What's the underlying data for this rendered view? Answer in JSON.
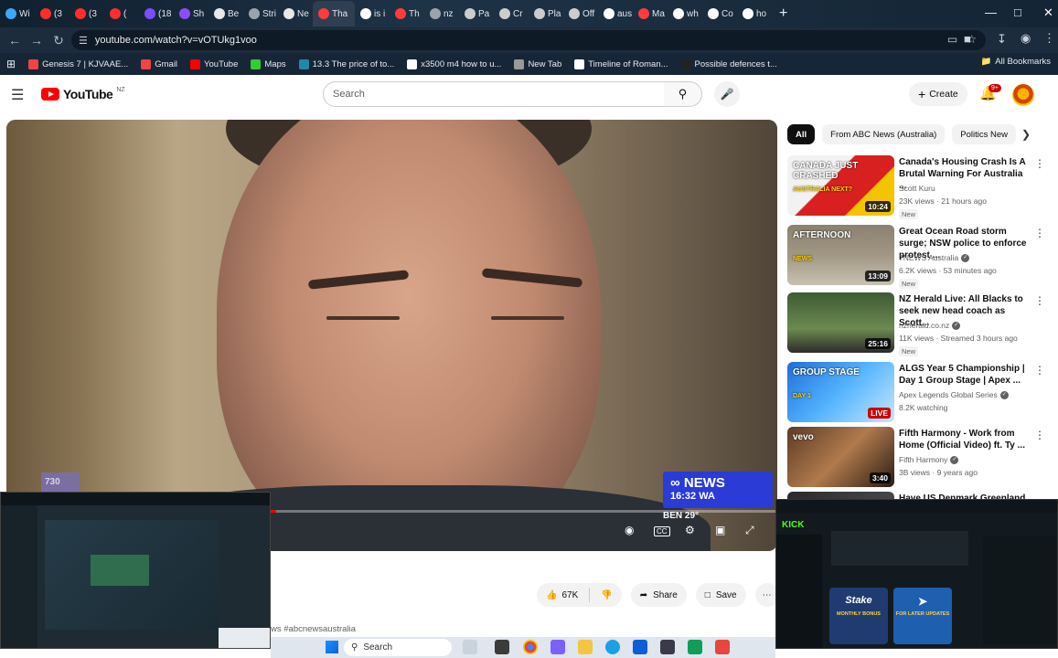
{
  "browser": {
    "tabs": [
      {
        "label": "Wi",
        "color": "#3aa8ff"
      },
      {
        "label": "(3",
        "color": "#ff2d2d"
      },
      {
        "label": "(3",
        "color": "#ff2d2d"
      },
      {
        "label": "(",
        "color": "#ff2d2d"
      },
      {
        "label": "(18",
        "color": "#7b4dff"
      },
      {
        "label": "Sh",
        "color": "#8a4dff"
      },
      {
        "label": "Be",
        "color": "#e8e8e8"
      },
      {
        "label": "Stri",
        "color": "#9aa4ad"
      },
      {
        "label": "Ne",
        "color": "#e8e8e8"
      },
      {
        "label": "Tha",
        "color": "#ff3b3b"
      },
      {
        "label": "is i",
        "color": "#ffffff"
      },
      {
        "label": "Th",
        "color": "#ff3b3b"
      },
      {
        "label": "nz",
        "color": "#9aa4ad"
      },
      {
        "label": "Pa",
        "color": "#cccccc"
      },
      {
        "label": "Cr",
        "color": "#cccccc"
      },
      {
        "label": "Pla",
        "color": "#cccccc"
      },
      {
        "label": "Off",
        "color": "#cccccc"
      },
      {
        "label": "aus",
        "color": "#ffffff"
      },
      {
        "label": "Ma",
        "color": "#ff3b3b"
      },
      {
        "label": "wh",
        "color": "#ffffff"
      },
      {
        "label": "Co",
        "color": "#ffffff"
      },
      {
        "label": "ho",
        "color": "#ffffff"
      }
    ],
    "new_tab_icon": "+",
    "url": "youtube.com/watch?v=vOTUkg1voo",
    "bookmarks": [
      {
        "label": "Genesis 7 | KJVAAE...",
        "color": "#e44"
      },
      {
        "label": "Gmail",
        "color": "#e44"
      },
      {
        "label": "YouTube",
        "color": "#f00"
      },
      {
        "label": "Maps",
        "color": "#3c3"
      },
      {
        "label": "13.3 The price of to...",
        "color": "#28a"
      },
      {
        "label": "x3500 m4 how to u...",
        "color": "#fff"
      },
      {
        "label": "New Tab",
        "color": "#999"
      },
      {
        "label": "Timeline of Roman...",
        "color": "#fff"
      },
      {
        "label": "Possible defences t...",
        "color": "#222"
      }
    ],
    "all_bookmarks": "All Bookmarks"
  },
  "header": {
    "logo_text": "YouTube",
    "logo_region": "NZ",
    "search_placeholder": "Search",
    "create_label": "Create",
    "notification_count": "9+"
  },
  "player": {
    "news_brand": "NEWS",
    "news_time": "16:32 WA",
    "news_weather": "BEN    29°",
    "corner_logo": "730",
    "progress": 0.35
  },
  "actions": {
    "likes": "67K",
    "share_label": "Share",
    "save_label": "Save",
    "more_icon": "⋯"
  },
  "description_snippet": "ws #abcnewsaustralia",
  "chips": [
    "All",
    "From ABC News (Australia)",
    "Politics New"
  ],
  "recommendations": [
    {
      "title": "Canada's Housing Crash Is A Brutal Warning For Australia ...",
      "channel": "Scott Kuru",
      "meta": "23K views · 21 hours ago",
      "badge": "New",
      "duration": "10:24",
      "thumb_text": "CANADA JUST CRASHED",
      "thumb_sub": "AUSTRALIA NEXT?",
      "verified": false
    },
    {
      "title": "Great Ocean Road storm surge; NSW police to enforce protest ...",
      "channel": "7NEWS Australia",
      "meta": "6.2K views · 53 minutes ago",
      "badge": "New",
      "duration": "13:09",
      "thumb_text": "AFTERNOON",
      "thumb_sub": "NEWS",
      "verified": true
    },
    {
      "title": "NZ Herald Live: All Blacks to seek new head coach as Scott...",
      "channel": "nzherald.co.nz",
      "meta": "11K views · Streamed 3 hours ago",
      "badge": "New",
      "duration": "25:16",
      "thumb_text": "",
      "thumb_sub": "",
      "verified": true
    },
    {
      "title": "ALGS Year 5 Championship | Day 1 Group Stage | Apex ...",
      "channel": "Apex Legends Global Series",
      "meta": "8.2K watching",
      "badge": "",
      "duration": "LIVE",
      "thumb_text": "GROUP STAGE",
      "thumb_sub": "DAY 1",
      "verified": true
    },
    {
      "title": "Fifth Harmony - Work from Home (Official Video) ft. Ty ...",
      "channel": "Fifth Harmony",
      "meta": "3B views · 9 years ago",
      "badge": "",
      "duration": "3:40",
      "thumb_text": "vevo",
      "thumb_sub": "",
      "verified": true
    },
    {
      "title": "Have US Denmark Greenland",
      "channel": "",
      "meta": "",
      "badge": "",
      "duration": "",
      "thumb_text": "",
      "thumb_sub": "",
      "verified": false
    }
  ],
  "overlay_right": {
    "brand": "KICK",
    "card1": "Stake",
    "card1_sub": "MONTHLY BONUS",
    "card2": "Telegram",
    "card2_sub": "FOR LATER UPDATES"
  },
  "taskbar": {
    "search_label": "Search"
  },
  "colors": {
    "yt_red": "#ff0000",
    "abc_blue": "#2a3bd6"
  }
}
